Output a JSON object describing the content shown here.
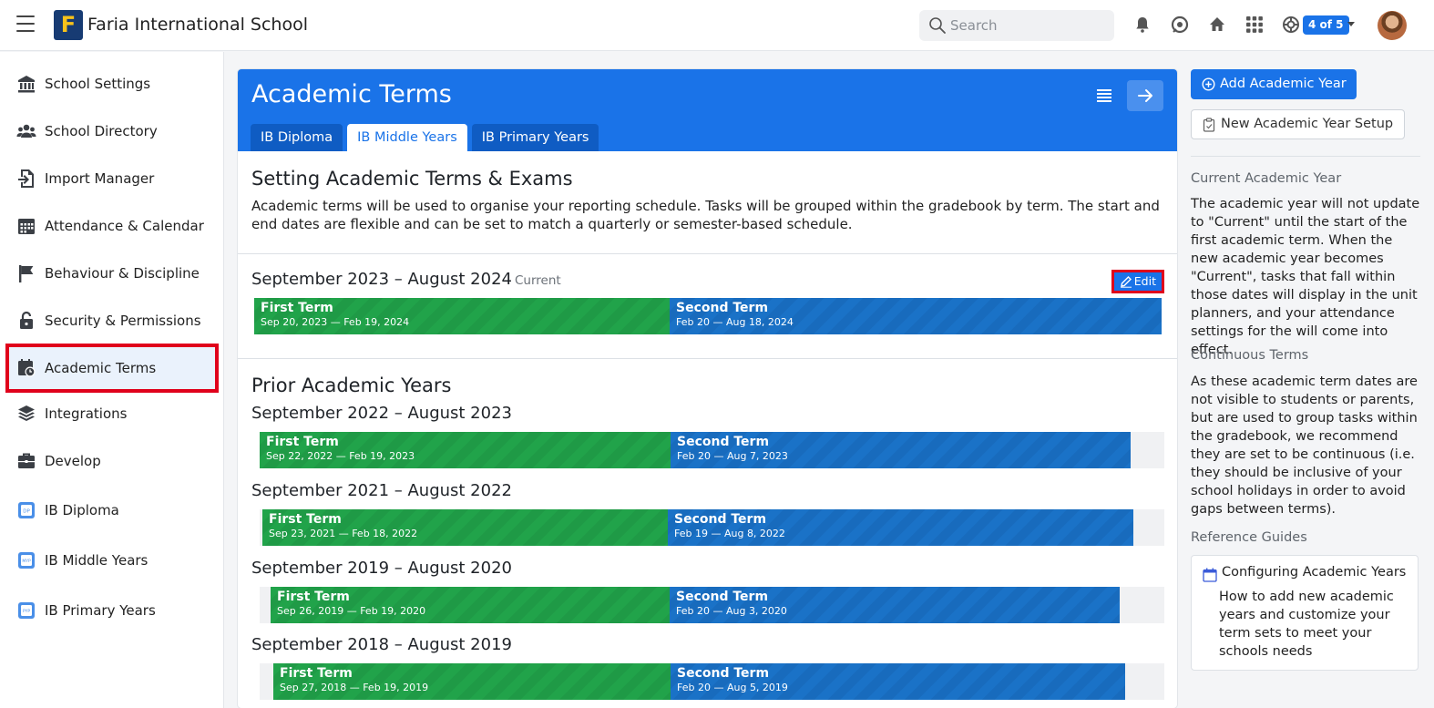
{
  "topbar": {
    "school_name": "Faria International School",
    "logo_letter": "F",
    "search_placeholder": "Search",
    "schools_badge": "4 of 5"
  },
  "sidebar": {
    "items": [
      {
        "label": "School Settings",
        "icon": "bank-icon"
      },
      {
        "label": "School Directory",
        "icon": "people-icon"
      },
      {
        "label": "Import Manager",
        "icon": "file-import-icon"
      },
      {
        "label": "Attendance & Calendar",
        "icon": "calendar-grid-icon"
      },
      {
        "label": "Behaviour & Discipline",
        "icon": "flag-icon"
      },
      {
        "label": "Security & Permissions",
        "icon": "lock-open-icon"
      },
      {
        "label": "Academic Terms",
        "icon": "calendar-clock-icon",
        "active": true
      },
      {
        "label": "Integrations",
        "icon": "layers-icon"
      },
      {
        "label": "Develop",
        "icon": "briefcase-icon"
      },
      {
        "label": "IB Diploma",
        "icon": "ib-dp-icon"
      },
      {
        "label": "IB Middle Years",
        "icon": "ib-myp-icon"
      },
      {
        "label": "IB Primary Years",
        "icon": "ib-pyp-icon"
      }
    ]
  },
  "main": {
    "title": "Academic Terms",
    "tabs": [
      {
        "label": "IB Diploma"
      },
      {
        "label": "IB Middle Years",
        "active": true
      },
      {
        "label": "IB Primary Years"
      }
    ],
    "section_title": "Setting Academic Terms & Exams",
    "description": "Academic terms will be used to organise your reporting schedule. Tasks will be grouped within the gradebook by term. The start and end dates are flexible and can be set to match a quarterly or semester-based schedule.",
    "current_year": {
      "title": "September 2023 – August 2024",
      "tag": "Current",
      "edit_label": "Edit",
      "terms": [
        {
          "name": "First Term",
          "dates": "Sep 20, 2023 — Feb 19, 2024"
        },
        {
          "name": "Second Term",
          "dates": "Feb 20 — Aug 18, 2024"
        }
      ]
    },
    "prior_title": "Prior Academic Years",
    "prior_years": [
      {
        "title": "September 2022 – August 2023",
        "terms": [
          {
            "name": "First Term",
            "dates": "Sep 22, 2022 — Feb 19, 2023"
          },
          {
            "name": "Second Term",
            "dates": "Feb 20 — Aug 7, 2023"
          }
        ]
      },
      {
        "title": "September 2021 – August 2022",
        "terms": [
          {
            "name": "First Term",
            "dates": "Sep 23, 2021 — Feb 18, 2022"
          },
          {
            "name": "Second Term",
            "dates": "Feb 19 — Aug 8, 2022"
          }
        ]
      },
      {
        "title": "September 2019 – August 2020",
        "terms": [
          {
            "name": "First Term",
            "dates": "Sep 26, 2019 — Feb 19, 2020"
          },
          {
            "name": "Second Term",
            "dates": "Feb 20 — Aug 3, 2020"
          }
        ]
      },
      {
        "title": "September 2018 – August 2019",
        "terms": [
          {
            "name": "First Term",
            "dates": "Sep 27, 2018 — Feb 19, 2019"
          },
          {
            "name": "Second Term",
            "dates": "Feb 20 — Aug 5, 2019"
          }
        ]
      }
    ]
  },
  "right_panel": {
    "add_year_label": "Add Academic Year",
    "new_setup_label": "New Academic Year Setup",
    "current_heading": "Current Academic Year",
    "current_text": "The academic year will not update to \"Current\" until the start of the first academic term. When the new academic year becomes \"Current\", tasks that fall within those dates will display in the unit planners, and your attendance settings for the will come into effect.",
    "continuous_heading": "Continuous Terms",
    "continuous_text": "As these academic term dates are not visible to students or parents, but are used to group tasks within the gradebook, we recommend they are set to be continuous (i.e. they should be inclusive of your school holidays in order to avoid gaps between terms).",
    "guides_heading": "Reference Guides",
    "guide_title": "Configuring Academic Years",
    "guide_desc": "How to add new academic years and customize your term sets to meet your schools needs"
  },
  "colors": {
    "brand_blue": "#1a73e8",
    "term_green": "#21a34a",
    "term_blue": "#1a72c7",
    "highlight_red": "#e0001b"
  }
}
